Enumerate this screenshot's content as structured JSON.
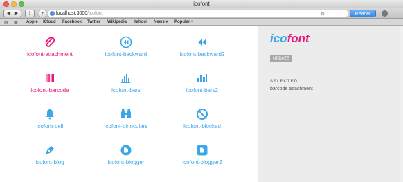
{
  "window": {
    "title": "icofont"
  },
  "toolbar": {
    "url_host": "localhost:3000",
    "url_path": "/icofont",
    "reader_label": "Reader"
  },
  "bookmarks": [
    "Apple",
    "iCloud",
    "Facebook",
    "Twitter",
    "Wikipedia",
    "Yahoo!",
    "News ▾",
    "Popular ▾"
  ],
  "icons": [
    {
      "name": "icofont-attachment",
      "selected": true
    },
    {
      "name": "icofont-backward"
    },
    {
      "name": "icofont-backward2"
    },
    {
      "name": "icofont-barcode",
      "selected": true
    },
    {
      "name": "icofont-bars"
    },
    {
      "name": "icofont-bars2"
    },
    {
      "name": "icofont-bell"
    },
    {
      "name": "icofont-binoculars"
    },
    {
      "name": "icofont-blocked"
    },
    {
      "name": "icofont-blog"
    },
    {
      "name": "icofont-blogger"
    },
    {
      "name": "icofont-blogger2"
    }
  ],
  "sidebar": {
    "logo_part1": "ico",
    "logo_part2": "font",
    "update_label": "UPDATE",
    "selected_heading": "SELECTED",
    "selected_value": "barcode attachment"
  },
  "colors": {
    "accent_blue": "#3ba7e8",
    "accent_pink": "#e8177d"
  }
}
